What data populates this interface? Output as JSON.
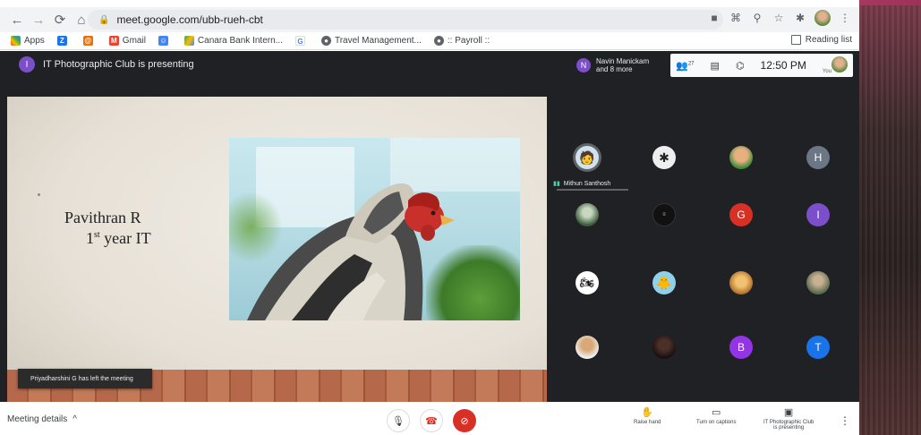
{
  "browser": {
    "url": "meet.google.com/ubb-rueh-cbt",
    "bookmarks": [
      "Apps",
      "",
      "",
      "Gmail",
      "",
      "Canara Bank Intern...",
      "",
      "Travel Management...",
      ":: Payroll ::"
    ],
    "reading_list": "Reading list"
  },
  "meet": {
    "presenter_initial": "I",
    "presenting_text": "IT Photographic Club is presenting",
    "others_initial": "N",
    "others_line1": "Navin Manickam",
    "others_line2": "and 8 more",
    "people_count": "27",
    "time": "12:50 PM",
    "you_label": "You"
  },
  "slide": {
    "name": "Pavithran R",
    "year_num": "1",
    "year_sup": "st",
    "year_rest": " year IT"
  },
  "toast": "Priyadharshini G has left the meeting",
  "participants": {
    "speaker_name": "Mithun Santhosh",
    "letters": [
      "H",
      "G",
      "I",
      "B",
      "T"
    ]
  },
  "bottom": {
    "meeting_details": "Meeting details",
    "raise_hand": "Raise hand",
    "captions": "Turn on captions",
    "presenting_l1": "IT Photographic Club",
    "presenting_l2": "is presenting"
  },
  "colors": {
    "purple": "#7b4fc9",
    "red": "#d93025",
    "orange": "#e8710a",
    "grey": "#6b7785",
    "blue": "#1a73e8",
    "meet_bg": "#202124"
  }
}
